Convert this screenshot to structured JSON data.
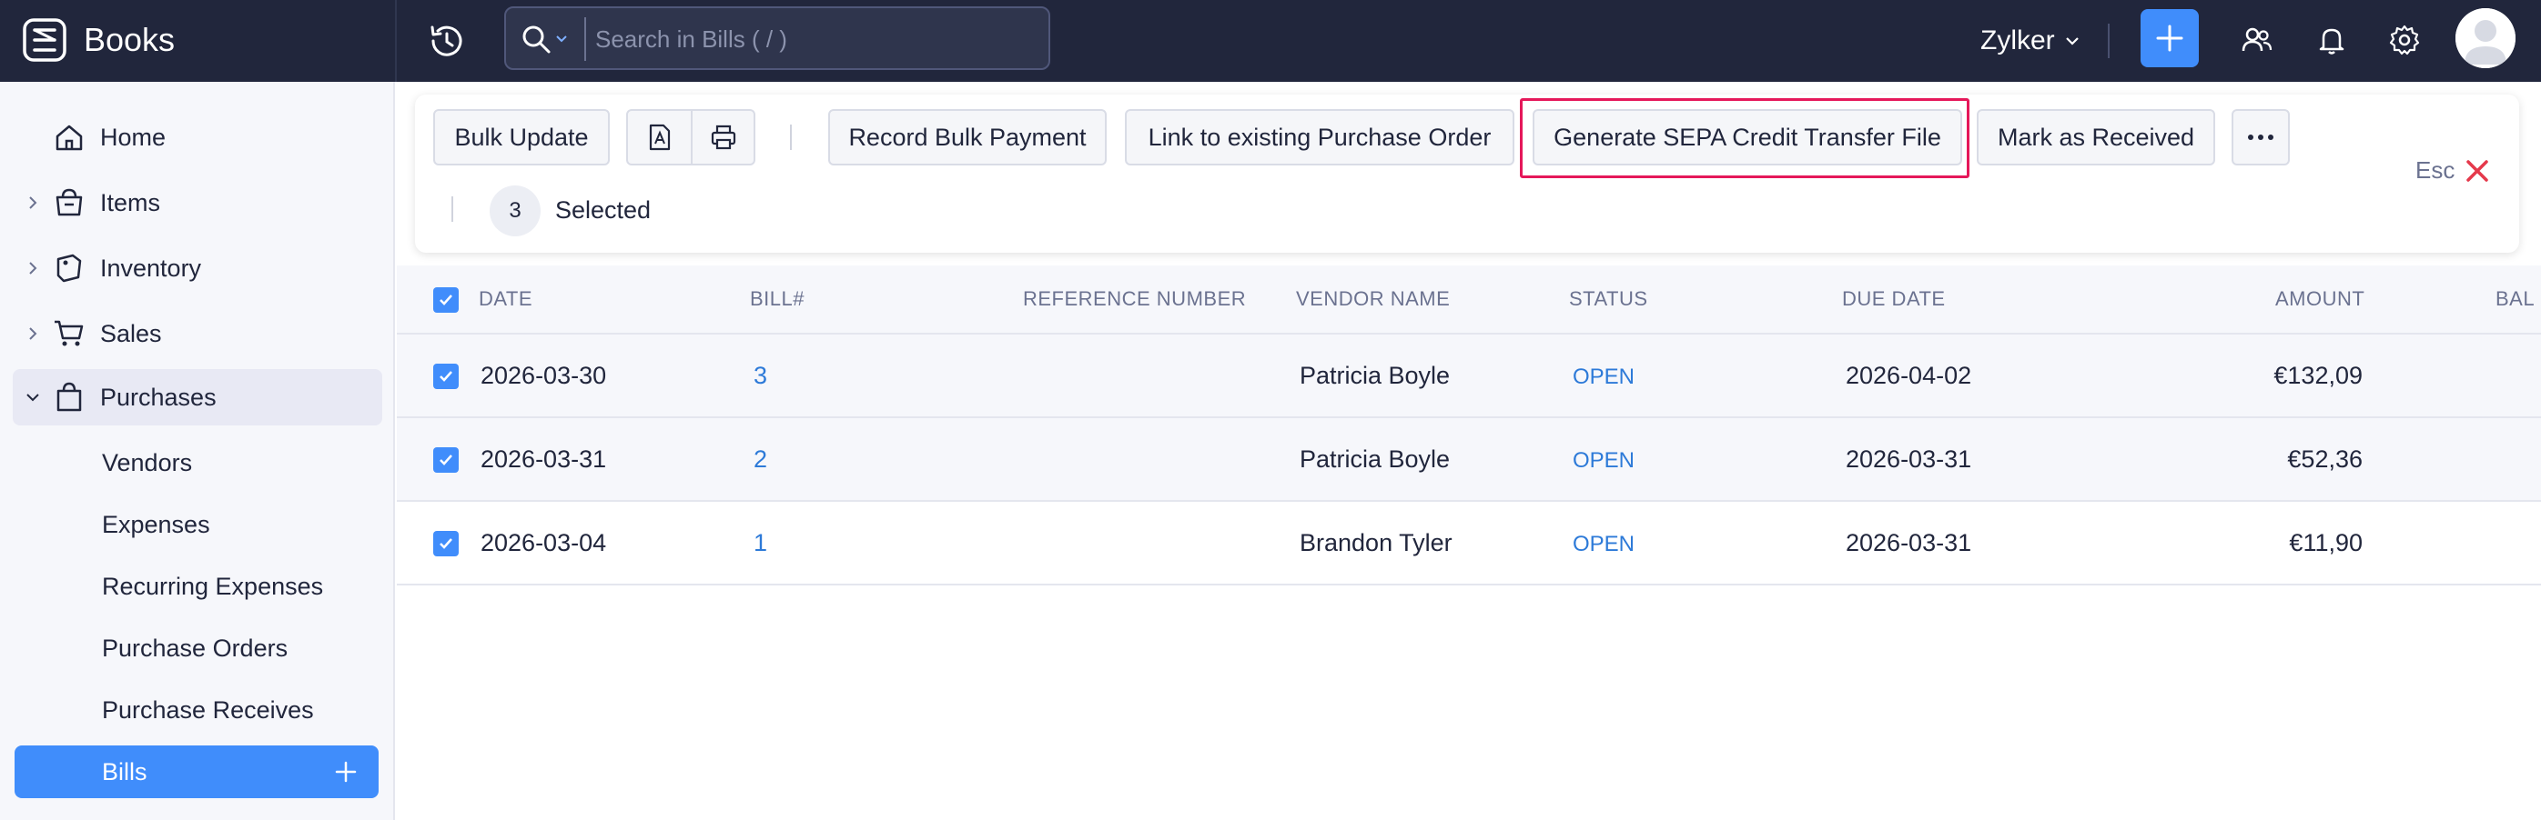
{
  "app": {
    "name": "Books"
  },
  "search": {
    "placeholder": "Search in Bills ( / )"
  },
  "header": {
    "org_name": "Zylker"
  },
  "sidebar": {
    "items": [
      {
        "label": "Home",
        "icon": "home-icon"
      },
      {
        "label": "Items",
        "icon": "basket-icon"
      },
      {
        "label": "Inventory",
        "icon": "inventory-icon"
      },
      {
        "label": "Sales",
        "icon": "cart-icon"
      },
      {
        "label": "Purchases",
        "icon": "bag-icon"
      }
    ],
    "purchases_sub": [
      "Vendors",
      "Expenses",
      "Recurring Expenses",
      "Purchase Orders",
      "Purchase Receives",
      "Bills"
    ]
  },
  "bulk": {
    "bulk_update": "Bulk Update",
    "record_bulk_payment": "Record Bulk Payment",
    "link_po": "Link to existing Purchase Order",
    "generate_sepa": "Generate SEPA Credit Transfer File",
    "mark_received": "Mark as Received",
    "selected_count": "3",
    "selected_label": "Selected",
    "esc_label": "Esc"
  },
  "table": {
    "headers": [
      "DATE",
      "BILL#",
      "REFERENCE NUMBER",
      "VENDOR NAME",
      "STATUS",
      "DUE DATE",
      "AMOUNT",
      "BAL"
    ],
    "rows": [
      {
        "date": "2026-03-30",
        "bill": "3",
        "reference": "",
        "vendor": "Patricia Boyle",
        "status": "OPEN",
        "due": "2026-04-02",
        "amount": "€132,09"
      },
      {
        "date": "2026-03-31",
        "bill": "2",
        "reference": "",
        "vendor": "Patricia Boyle",
        "status": "OPEN",
        "due": "2026-03-31",
        "amount": "€52,36"
      },
      {
        "date": "2026-03-04",
        "bill": "1",
        "reference": "",
        "vendor": "Brandon Tyler",
        "status": "OPEN",
        "due": "2026-03-31",
        "amount": "€11,90"
      }
    ]
  },
  "colors": {
    "accent": "#408dfb",
    "topbar": "#21263c",
    "highlight": "#e5185a",
    "link": "#2d7ad8",
    "esc_x": "#e5394b"
  }
}
